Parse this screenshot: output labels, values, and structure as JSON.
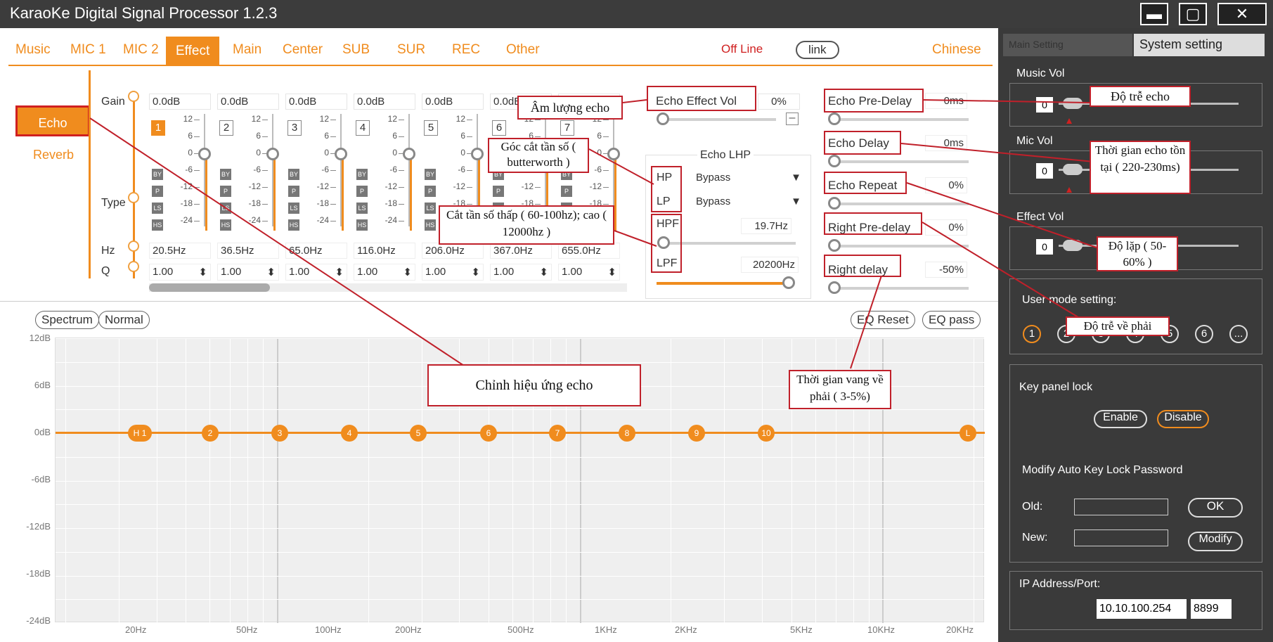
{
  "window": {
    "title": "KaraoKe Digital Signal Processor 1.2.3"
  },
  "tabs": [
    "Music",
    "MIC 1",
    "MIC 2",
    "Effect",
    "Main",
    "Center",
    "SUB",
    "SUR",
    "REC",
    "Other"
  ],
  "status": {
    "offline": "Off Line",
    "link": "link",
    "language": "Chinese"
  },
  "side": {
    "echo": "Echo",
    "reverb": "Reverb"
  },
  "eq": {
    "gain_label": "Gain",
    "type_label": "Type",
    "hz_label": "Hz",
    "q_label": "Q",
    "bands": [
      {
        "num": "1",
        "gain": "0.0dB",
        "hz": "20.5Hz",
        "q": "1.00"
      },
      {
        "num": "2",
        "gain": "0.0dB",
        "hz": "36.5Hz",
        "q": "1.00"
      },
      {
        "num": "3",
        "gain": "0.0dB",
        "hz": "65.0Hz",
        "q": "1.00"
      },
      {
        "num": "4",
        "gain": "0.0dB",
        "hz": "116.0Hz",
        "q": "1.00"
      },
      {
        "num": "5",
        "gain": "0.0dB",
        "hz": "206.0Hz",
        "q": "1.00"
      },
      {
        "num": "6",
        "gain": "0.0dB",
        "hz": "367.0Hz",
        "q": "1.00"
      },
      {
        "num": "7",
        "gain": "",
        "hz": "655.0Hz",
        "q": "1.00"
      }
    ],
    "scale": [
      "12",
      "6",
      "0",
      "-6",
      "-12",
      "-18",
      "-24"
    ],
    "tags": [
      "BY",
      "P",
      "LS",
      "HS"
    ]
  },
  "echo_effect": {
    "label": "Echo Effect Vol",
    "value": "0%"
  },
  "echo_lhp": {
    "title": "Echo LHP",
    "hp": "HP",
    "lp": "LP",
    "hp_value": "Bypass",
    "lp_value": "Bypass",
    "hpf": "HPF",
    "hpf_value": "19.7Hz",
    "lpf": "LPF",
    "lpf_value": "20200Hz",
    "hpf_level": 0.0,
    "lpf_level": 1.0
  },
  "echo_params": [
    {
      "label": "Echo Pre-Delay",
      "value": "0ms"
    },
    {
      "label": "Echo Delay",
      "value": "0ms"
    },
    {
      "label": "Echo Repeat",
      "value": "0%"
    },
    {
      "label": "Right Pre-delay",
      "value": "0%"
    },
    {
      "label": "Right delay",
      "value": "-50%"
    }
  ],
  "chart": {
    "buttons": {
      "spectrum": "Spectrum",
      "normal": "Normal",
      "reset": "EQ Reset",
      "pass": "EQ pass"
    },
    "ylabels": [
      "12dB",
      "6dB",
      "0dB",
      "-6dB",
      "-12dB",
      "-18dB",
      "-24dB"
    ],
    "xlabels": [
      "20Hz",
      "50Hz",
      "100Hz",
      "200Hz",
      "500Hz",
      "1KHz",
      "2KHz",
      "5KHz",
      "10KHz",
      "20KHz"
    ],
    "nodes": [
      "H 1",
      "2",
      "3",
      "4",
      "5",
      "6",
      "7",
      "8",
      "9",
      "10",
      "L"
    ]
  },
  "right": {
    "tab1": "Main Setting",
    "tab2": "System setting",
    "music_vol": {
      "label": "Music Vol",
      "value": "0"
    },
    "mic_vol": {
      "label": "Mic Vol",
      "value": "0"
    },
    "effect_vol": {
      "label": "Effect Vol",
      "value": "0"
    },
    "user_mode": "User mode setting:",
    "modes": [
      "1",
      "2",
      "3",
      "4",
      "5",
      "6",
      "..."
    ],
    "key_lock": "Key panel lock",
    "enable": "Enable",
    "disable": "Disable",
    "modify_pwd": "Modify Auto Key Lock Password",
    "old": "Old:",
    "new": "New:",
    "ok": "OK",
    "modify": "Modify",
    "ip_label": "IP Address/Port:",
    "ip": "10.10.100.254",
    "port": "8899"
  },
  "annotations": {
    "am_luong": "Âm lượng echo",
    "goc_cat": "Góc cắt tần số ( butterworth )",
    "cat_tan": "Cắt tần số thấp ( 60-100hz); cao ( 12000hz )",
    "chinh": "Chỉnh hiệu ứng echo",
    "thoi_gian_vang": "Thời gian vang về phải ( 3-5%)",
    "do_tre": "Độ trễ echo",
    "thoi_gian_ton": "Thời gian echo tồn tại ( 220-230ms)",
    "do_lap": "Độ lặp ( 50-60% )",
    "do_tre_phai": "Độ trễ về phải"
  },
  "colors": {
    "accent": "#f08c1e",
    "annotation": "#c0202a",
    "panel": "#3a3a3a"
  }
}
